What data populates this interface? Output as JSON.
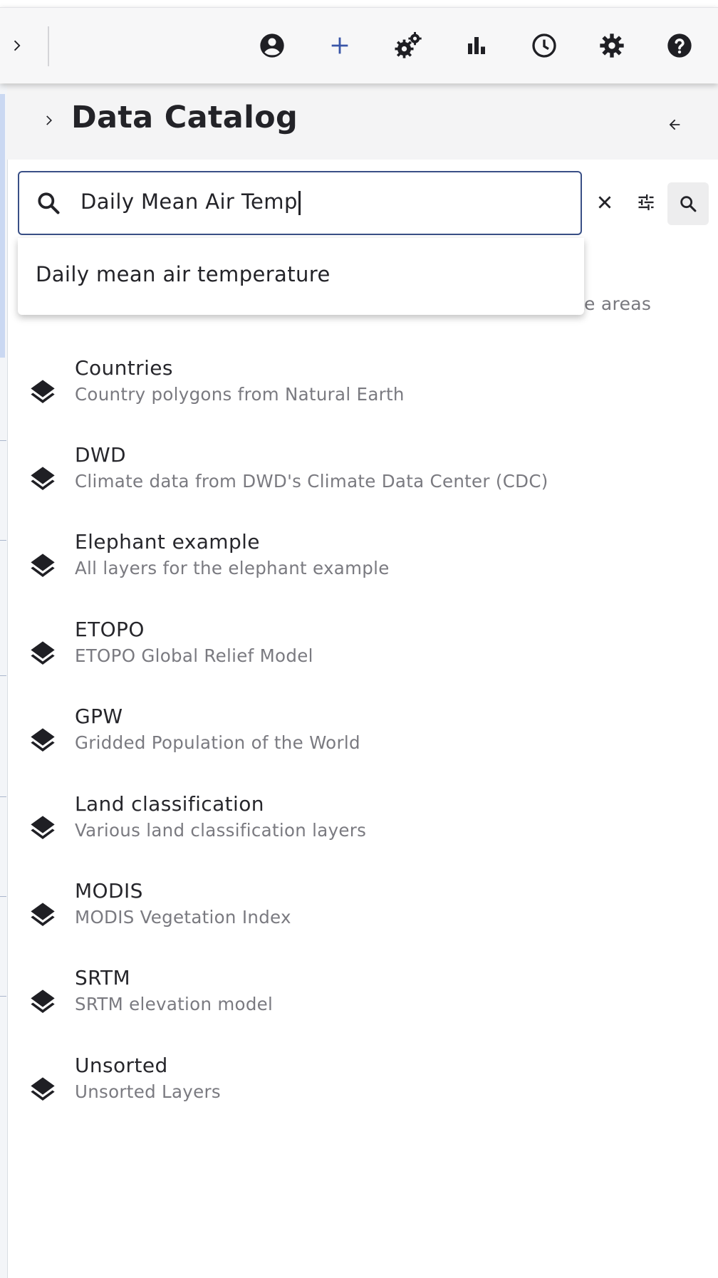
{
  "toolbar": {
    "icons": [
      "chevron-right-icon",
      "account-circle-icon",
      "add-icon",
      "gears-icon",
      "bar-chart-icon",
      "clock-icon",
      "settings-icon",
      "help-icon"
    ],
    "accent": "#3a56a8"
  },
  "panel": {
    "title": "Data Catalog"
  },
  "search": {
    "value": "Daily Mean Air Temp",
    "border_color": "#394f86"
  },
  "autocomplete": {
    "items": [
      "Daily mean air temperature"
    ]
  },
  "obscured_text": "e areas",
  "catalog": {
    "items": [
      {
        "title": "Countries",
        "subtitle": "Country polygons from Natural Earth"
      },
      {
        "title": "DWD",
        "subtitle": "Climate data from DWD's Climate Data Center (CDC)"
      },
      {
        "title": "Elephant example",
        "subtitle": "All layers for the elephant example"
      },
      {
        "title": "ETOPO",
        "subtitle": "ETOPO Global Relief Model"
      },
      {
        "title": "GPW",
        "subtitle": "Gridded Population of the World"
      },
      {
        "title": "Land classification",
        "subtitle": "Various land classification layers"
      },
      {
        "title": "MODIS",
        "subtitle": "MODIS Vegetation Index"
      },
      {
        "title": "SRTM",
        "subtitle": "SRTM elevation model"
      },
      {
        "title": "Unsorted",
        "subtitle": "Unsorted Layers"
      }
    ]
  }
}
